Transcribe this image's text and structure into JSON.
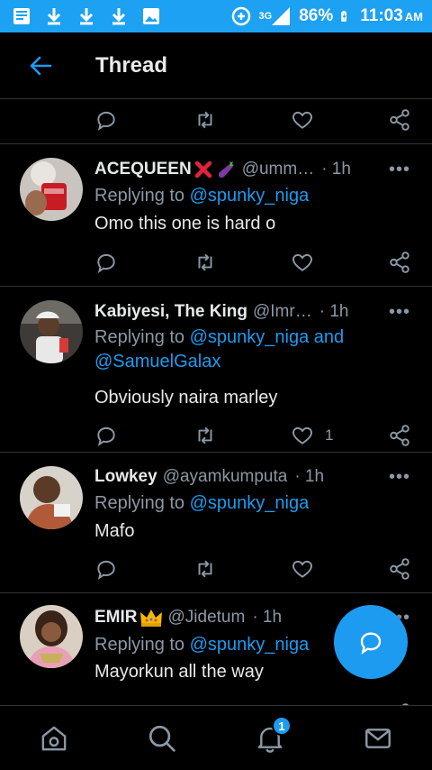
{
  "status_bar": {
    "network": "3G",
    "battery": "86%",
    "time": "11:03",
    "ampm": "AM",
    "icons": [
      "gallery-icon",
      "download-icon",
      "download-icon",
      "download-icon",
      "image-icon",
      "data-saver-icon",
      "signal-icon",
      "battery-charging-icon"
    ]
  },
  "header": {
    "title": "Thread"
  },
  "tweets": [
    {
      "name": "ACEQUEEN",
      "emoji": [
        "cross-mark-icon",
        "eggplant-icon"
      ],
      "handle": "@umm…",
      "time": "· 1h",
      "replying_prefix": "Replying to ",
      "mentions": [
        "@spunky_niga"
      ],
      "text": "Omo this one is hard o",
      "likes": ""
    },
    {
      "name": "Kabiyesi, The King",
      "emoji": [],
      "handle": "@Imr…",
      "time": "· 1h",
      "replying_prefix": "Replying to ",
      "mentions": [
        "@spunky_niga",
        "@SamuelGalax"
      ],
      "joiner": " and ",
      "text": "Obviously naira marley",
      "likes": "1"
    },
    {
      "name": "Lowkey",
      "emoji": [],
      "handle": "@ayamkumputa",
      "time": "· 1h",
      "replying_prefix": "Replying to ",
      "mentions": [
        "@spunky_niga"
      ],
      "text": "Mafo",
      "likes": ""
    },
    {
      "name": "EMIR",
      "emoji": [
        "crown-icon"
      ],
      "handle": "@Jidetum",
      "time": "· 1h",
      "replying_prefix": "Replying to ",
      "mentions": [
        "@spunky_niga"
      ],
      "text": "Mayorkun all the way",
      "likes": ""
    }
  ],
  "bottom_nav": {
    "items": [
      "home-icon",
      "search-icon",
      "notifications-icon",
      "messages-icon"
    ],
    "notification_badge": "1"
  },
  "colors": {
    "accent": "#1d9bf0",
    "background": "#000000",
    "divider": "#2f3336",
    "secondary_text": "#8b98a5",
    "status_bar": "#1da1f2"
  }
}
